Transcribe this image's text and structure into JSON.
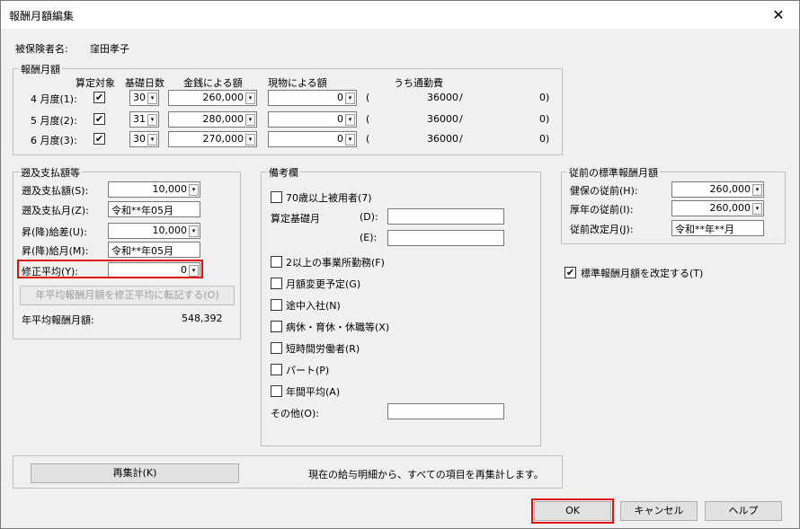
{
  "window": {
    "title": "報酬月額編集",
    "close_glyph": "✕"
  },
  "insured": {
    "label": "被保険者名:",
    "name": "窪田孝子"
  },
  "salary": {
    "group_label": "報酬月額",
    "headers": {
      "target": "算定対象",
      "days": "基礎日数",
      "cash": "金銭による額",
      "kind": "現物による額",
      "commute": "うち通勤費"
    },
    "rows": [
      {
        "month": "4 月度(1):",
        "checked": "✔",
        "days": "30",
        "cash": "260,000",
        "kind": "0",
        "open": "(",
        "commute": "36000",
        "slash": "/",
        "close": "0)"
      },
      {
        "month": "5 月度(2):",
        "checked": "✔",
        "days": "31",
        "cash": "280,000",
        "kind": "0",
        "open": "(",
        "commute": "36000",
        "slash": "/",
        "close": "0)"
      },
      {
        "month": "6 月度(3):",
        "checked": "✔",
        "days": "30",
        "cash": "270,000",
        "kind": "0",
        "open": "(",
        "commute": "36000",
        "slash": "/",
        "close": "0)"
      }
    ]
  },
  "retro": {
    "group_label": "遡及支払額等",
    "pay_amount_label": "遡及支払額(S):",
    "pay_amount": "10,000",
    "pay_month_label": "遡及支払月(Z):",
    "pay_month": "令和**年05月",
    "diff_label": "昇(降)給差(U):",
    "diff": "10,000",
    "diff_month_label": "昇(降)給月(M):",
    "diff_month": "令和**年05月",
    "adjust_label": "修正平均(Y):",
    "adjust": "0",
    "transfer_button": "年平均報酬月額を修正平均に転記する(O)",
    "annual_label": "年平均報酬月額:",
    "annual": "548,392"
  },
  "notes": {
    "group_label": "備考欄",
    "over70": "70歳以上被用者(7)",
    "base_month_label": "算定基礎月",
    "d_label": "(D):",
    "d_value": "",
    "e_label": "(E):",
    "e_value": "",
    "checks": [
      "2以上の事業所勤務(F)",
      "月額変更予定(G)",
      "途中入社(N)",
      "病休・育休・休職等(X)",
      "短時間労働者(R)",
      "パート(P)",
      "年間平均(A)"
    ],
    "other_label": "その他(O):",
    "other_value": ""
  },
  "previous": {
    "group_label": "従前の標準報酬月額",
    "health_label": "健保の従前(H):",
    "health": "260,000",
    "pension_label": "厚年の従前(I):",
    "pension": "260,000",
    "revision_label": "従前改定月(J):",
    "revision": "令和**年**月"
  },
  "revise_standard": {
    "label": "標準報酬月額を改定する(T)",
    "checked": "✔"
  },
  "recalc": {
    "button": "再集計(K)",
    "description": "現在の給与明細から、すべての項目を再集計します。"
  },
  "footer": {
    "ok": "OK",
    "cancel": "キャンセル",
    "help": "ヘルプ"
  },
  "icons": {
    "dropdown": "▾"
  },
  "colors": {
    "highlight": "#e01010"
  }
}
